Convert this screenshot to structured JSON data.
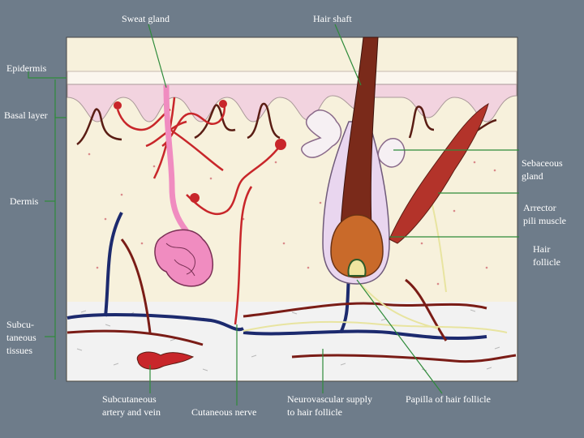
{
  "labels": {
    "sweat_gland": "Sweat gland",
    "hair_shaft": "Hair shaft",
    "epidermis": "Epidermis",
    "basal_layer": "Basal layer",
    "dermis": "Dermis",
    "subcutaneous_line1": "Subcu-",
    "subcutaneous_line2": "taneous",
    "subcutaneous_line3": "tissues",
    "sebaceous_line1": "Sebaceous",
    "sebaceous_line2": "gland",
    "arrector_line1": "Arrector",
    "arrector_line2": "pili muscle",
    "hair_follicle_line1": "Hair",
    "hair_follicle_line2": "follicle",
    "artery_vein_line1": "Subcutaneous",
    "artery_vein_line2": "artery and vein",
    "cutaneous_nerve": "Cutaneous nerve",
    "neurovascular_line1": "Neurovascular supply",
    "neurovascular_line2": "to hair follicle",
    "papilla": "Papilla of hair follicle"
  },
  "colors": {
    "background": "#6e7c8a",
    "leader": "#2e8b3a",
    "epidermis": "#f2d3df",
    "dermis": "#f7f1dc",
    "hair": "#7a2a1a",
    "artery": "#c8262a",
    "vein": "#1c2a6e",
    "gland": "#f08cc0",
    "nerve": "#e8e4a0"
  }
}
